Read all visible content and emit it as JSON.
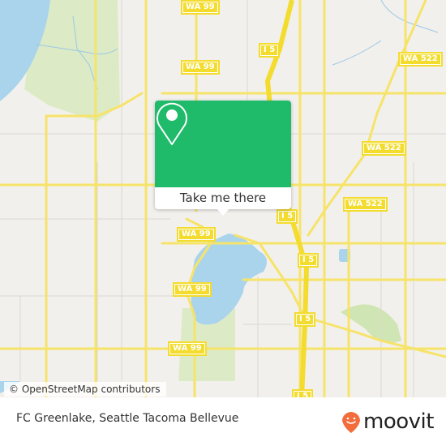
{
  "map": {
    "attribution": "© OpenStreetMap contributors",
    "colors": {
      "land": "#f2f0ec",
      "water": "#a9d4ec",
      "park": "#d9eac1",
      "major_road": "#f6e36a",
      "minor_road": "#d9d3cd",
      "shield": "#f3dc2e"
    },
    "road_shields": [
      "WA 99",
      "WA 99",
      "WA 99",
      "I 5",
      "WA 522",
      "WA 522",
      "WA 522",
      "WA 99",
      "WA 99",
      "WA 99",
      "I 5",
      "I 5",
      "I 5",
      "I 5"
    ]
  },
  "popup": {
    "icon": "map-pin-icon",
    "button_label": "Take me there",
    "accent_color": "#1fbb6b"
  },
  "footer": {
    "place_name": "FC Greenlake, Seattle Tacoma Bellevue",
    "brand": {
      "logo_icon": "moovit-smile-pin-icon",
      "name": "moovit",
      "color": "#f26c3c"
    }
  }
}
